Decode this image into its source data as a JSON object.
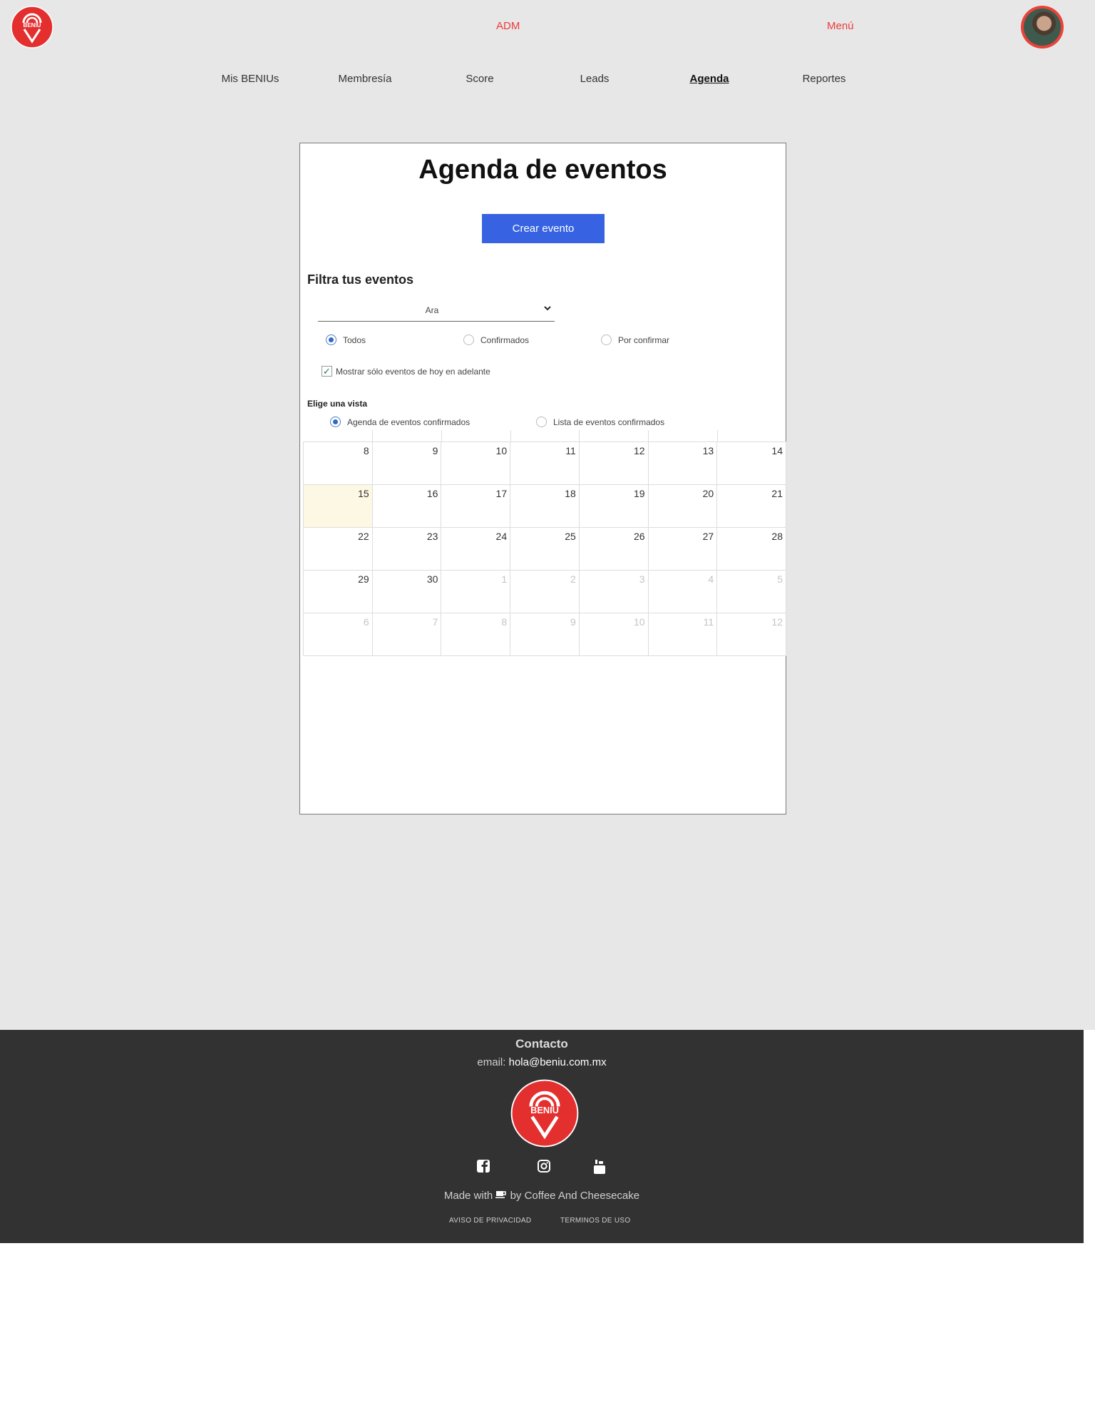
{
  "header": {
    "brand": "BENIU",
    "adm_label": "ADM",
    "menu_label": "Menú"
  },
  "nav": {
    "items": [
      "Mis BENIUs",
      "Membresía",
      "Score",
      "Leads",
      "Agenda",
      "Reportes"
    ],
    "active": "Agenda"
  },
  "card": {
    "title": "Agenda de eventos",
    "create_button": "Crear evento",
    "filter_title": "Filtra tus eventos",
    "select_value": "Ara",
    "status_options": [
      {
        "label": "Todos",
        "selected": true
      },
      {
        "label": "Confirmados",
        "selected": false
      },
      {
        "label": "Por confirmar",
        "selected": false
      }
    ],
    "checkbox_label": "Mostrar sólo eventos de hoy en adelante",
    "checkbox_checked": true,
    "view_title": "Elige una vista",
    "view_options": [
      {
        "label": "Agenda de eventos confirmados",
        "selected": true
      },
      {
        "label": "Lista de eventos confirmados",
        "selected": false
      }
    ]
  },
  "calendar": {
    "weeks": [
      [
        "8",
        "9",
        "10",
        "11",
        "12",
        "13",
        "14"
      ],
      [
        "15",
        "16",
        "17",
        "18",
        "19",
        "20",
        "21"
      ],
      [
        "22",
        "23",
        "24",
        "25",
        "26",
        "27",
        "28"
      ],
      [
        "29",
        "30",
        "1",
        "2",
        "3",
        "4",
        "5"
      ],
      [
        "6",
        "7",
        "8",
        "9",
        "10",
        "11",
        "12"
      ]
    ],
    "today": "15"
  },
  "footer": {
    "contact_title": "Contacto",
    "email_label": "email:",
    "email": "hola@beniu.com.mx",
    "brand": "BENIU",
    "made_with_prefix": "Made with",
    "made_with_suffix": "by Coffee And Cheesecake",
    "privacy": "AVISO DE PRIVACIDAD",
    "terms": "TERMINOS DE USO"
  },
  "colors": {
    "brand_red": "#ec3b3b",
    "primary_button": "#3763e3",
    "today_highlight": "#fcf8e3",
    "footer_bg": "#323232"
  },
  "icons": [
    "facebook-icon",
    "instagram-icon",
    "youtube-icon",
    "coffee-icon"
  ]
}
